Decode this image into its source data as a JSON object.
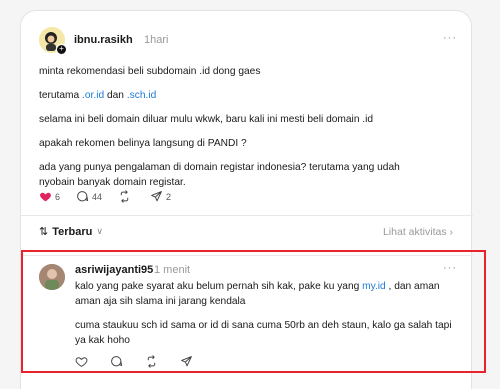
{
  "post": {
    "username": "ibnu.rasikh",
    "time": "1hari",
    "more": "···",
    "lines": {
      "l1": "minta rekomendasi beli subdomain .id dong gaes",
      "l2_prefix": "terutama ",
      "l2_link1": ".or.id",
      "l2_mid": " dan ",
      "l2_link2": ".sch.id",
      "l3": "selama ini beli domain diluar mulu wkwk, baru kali ini mesti beli domain .id",
      "l4": "apakah rekomen belinya langsung di PANDI ?",
      "l5a": "ada yang punya pengalaman di domain registar indonesia? terutama yang udah",
      "l5b": "nyobain banyak domain registar."
    },
    "likes": "6",
    "comments": "44",
    "reposts": "",
    "shares": "2"
  },
  "sort": {
    "label": "Terbaru",
    "chev": "∨"
  },
  "activity_label": "Lihat aktivitas ›",
  "reply": {
    "username": "asriwijayanti95",
    "time": "1 menit",
    "more": "···",
    "p1a_prefix": "kalo yang pake syarat aku belum pernah sih kak, pake ku yang ",
    "p1a_link": "my.id",
    "p1a_suffix": " , dan aman",
    "p1b": "aman aja sih slama ini jarang kendala",
    "p2a": "cuma staukuu sch id sama or id di sana cuma 50rb an deh staun, kalo ga salah tapi",
    "p2b": "ya kak hoho"
  },
  "colors": {
    "like": "#e0245e",
    "link": "#1d7bd8",
    "highlight": "#e8232d"
  },
  "icons": [
    "heart-icon",
    "comment-icon",
    "repost-icon",
    "share-icon"
  ]
}
